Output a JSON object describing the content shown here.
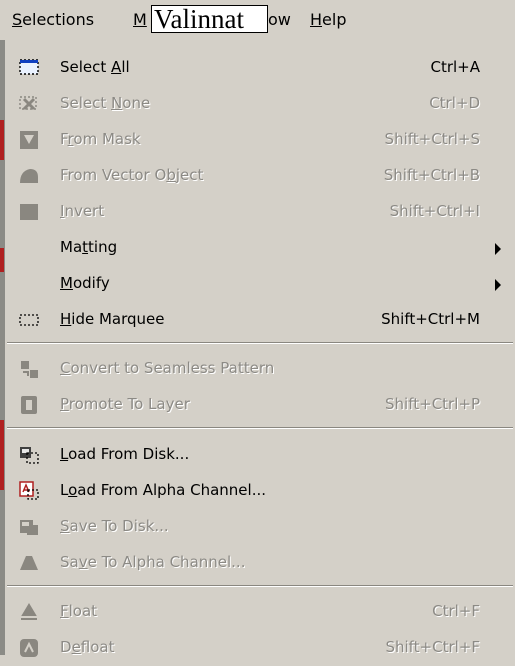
{
  "menubar": {
    "selections": "Selections",
    "m": "M",
    "overlay_text": "Valinnat",
    "ow": "ow",
    "help": "Help"
  },
  "menu": {
    "select_all": {
      "label": "Select All",
      "shortcut": "Ctrl+A"
    },
    "select_none": {
      "label": "Select None",
      "shortcut": "Ctrl+D"
    },
    "from_mask": {
      "label": "From Mask",
      "shortcut": "Shift+Ctrl+S"
    },
    "from_vector": {
      "label": "From Vector Object",
      "shortcut": "Shift+Ctrl+B"
    },
    "invert": {
      "label": "Invert",
      "shortcut": "Shift+Ctrl+I"
    },
    "matting": {
      "label": "Matting"
    },
    "modify": {
      "label": "Modify"
    },
    "hide_marquee": {
      "label": "Hide Marquee",
      "shortcut": "Shift+Ctrl+M"
    },
    "convert_seamless": {
      "label": "Convert to Seamless Pattern"
    },
    "promote_layer": {
      "label": "Promote To Layer",
      "shortcut": "Shift+Ctrl+P"
    },
    "load_disk": {
      "label": "Load From Disk..."
    },
    "load_alpha": {
      "label": "Load From Alpha Channel..."
    },
    "save_disk": {
      "label": "Save To Disk..."
    },
    "save_alpha": {
      "label": "Save To Alpha Channel..."
    },
    "float": {
      "label": "Float",
      "shortcut": "Ctrl+F"
    },
    "defloat": {
      "label": "Defloat",
      "shortcut": "Shift+Ctrl+F"
    }
  },
  "colors": {
    "menu_bg": "#d4d0c8",
    "disabled_text": "#8c8a85",
    "highlight_red": "#b02020"
  }
}
